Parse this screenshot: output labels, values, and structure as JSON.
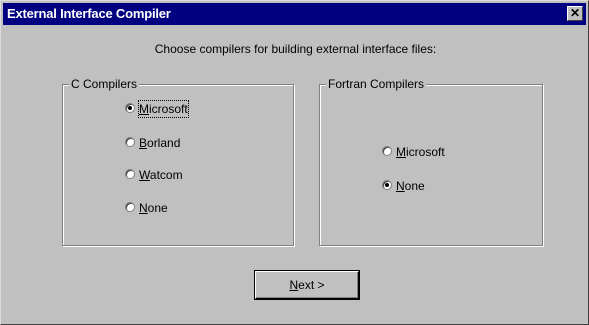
{
  "window": {
    "title": "External Interface Compiler",
    "close_glyph": "✕"
  },
  "instruction": "Choose compilers for building external interface files:",
  "c_group": {
    "legend": "C Compilers",
    "options": [
      {
        "first": "M",
        "rest": "icrosoft",
        "checked": true
      },
      {
        "first": "B",
        "rest": "orland",
        "checked": false
      },
      {
        "first": "W",
        "rest": "atcom",
        "checked": false
      },
      {
        "first": "N",
        "rest": "one",
        "checked": false
      }
    ]
  },
  "fortran_group": {
    "legend": "Fortran Compilers",
    "options": [
      {
        "first": "M",
        "rest": "icrosoft",
        "checked": false
      },
      {
        "first": "N",
        "rest": "one",
        "checked": true
      }
    ]
  },
  "next_button": {
    "first": "N",
    "rest": "ext >"
  },
  "colors": {
    "titlebar": "#000080",
    "face": "#c0c0c0"
  }
}
